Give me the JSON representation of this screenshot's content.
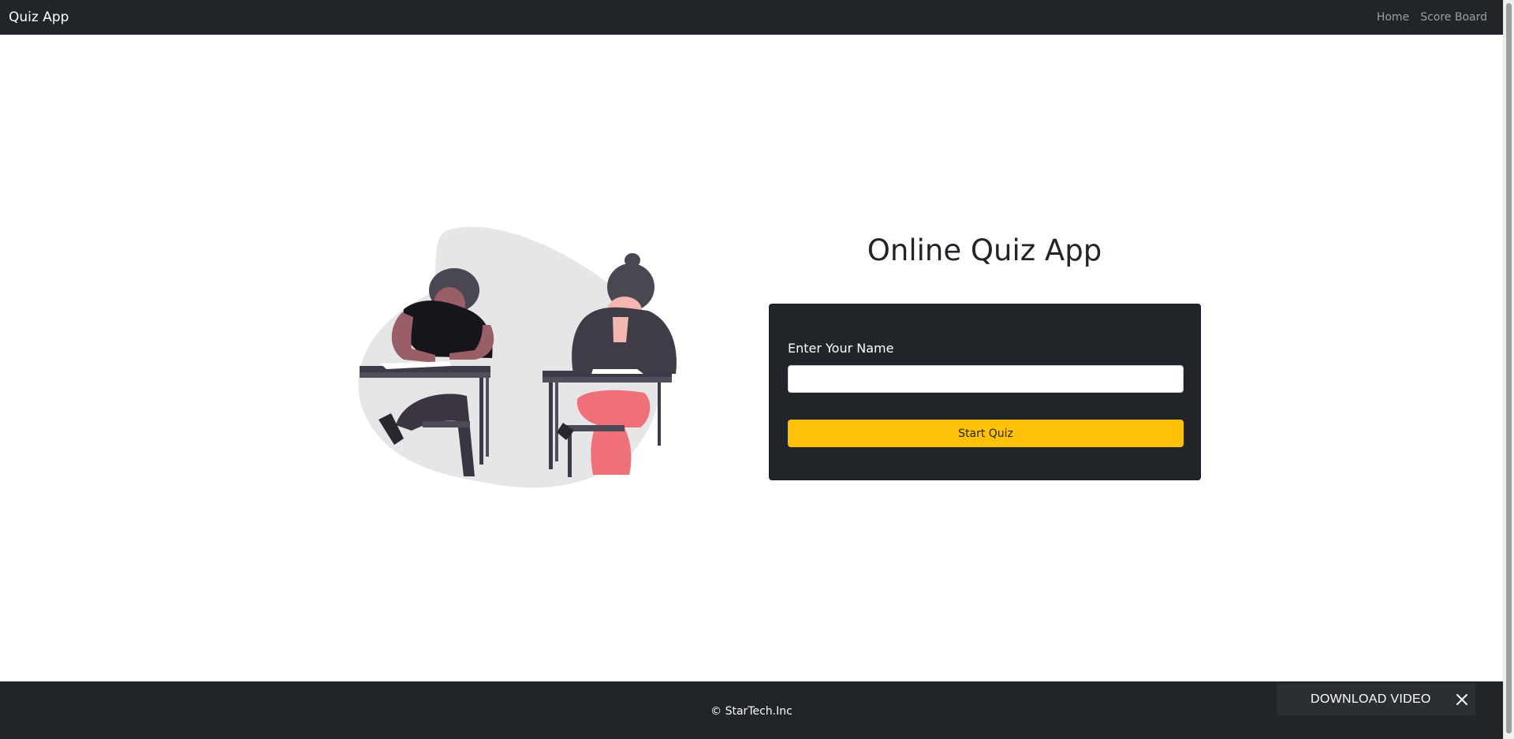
{
  "navbar": {
    "brand": "Quiz App",
    "links": [
      {
        "label": "Home"
      },
      {
        "label": "Score Board"
      }
    ]
  },
  "main": {
    "title": "Online Quiz App",
    "illustration_icon": "students-taking-exam-illustration",
    "form": {
      "name_label": "Enter Your Name",
      "name_value": "",
      "name_placeholder": "",
      "start_label": "Start Quiz"
    }
  },
  "footer": {
    "copyright": "© StarTech.Inc"
  },
  "download_bar": {
    "label": "DOWNLOAD VIDEO",
    "close_icon": "close-icon"
  },
  "colors": {
    "navbar": "#212529",
    "card": "#212529",
    "button": "#ffc107",
    "footer": "#212529"
  }
}
